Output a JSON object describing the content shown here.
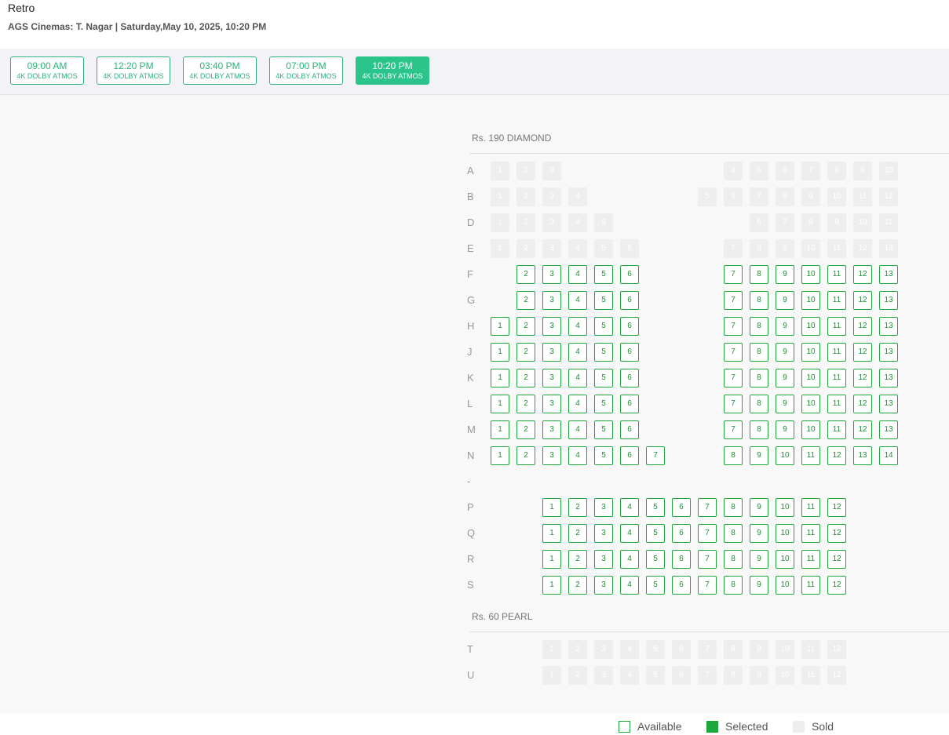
{
  "header": {
    "title": "Retro",
    "theatre": "AGS Cinemas: T. Nagar | Saturday,May 10, 2025, 10:20 PM"
  },
  "showtimes": [
    {
      "time": "09:00 AM",
      "format": "4K DOLBY ATMOS",
      "selected": false
    },
    {
      "time": "12:20 PM",
      "format": "4K DOLBY ATMOS",
      "selected": false
    },
    {
      "time": "03:40 PM",
      "format": "4K DOLBY ATMOS",
      "selected": false
    },
    {
      "time": "07:00 PM",
      "format": "4K DOLBY ATMOS",
      "selected": false
    },
    {
      "time": "10:20 PM",
      "format": "4K DOLBY ATMOS",
      "selected": true
    }
  ],
  "sections": [
    {
      "label": "Rs. 190 DIAMOND",
      "rows": [
        {
          "label": "A",
          "status": "sold",
          "seats": [
            [
              1,
              1
            ],
            [
              2,
              2
            ],
            [
              3,
              3
            ],
            [
              10,
              4
            ],
            [
              11,
              5
            ],
            [
              12,
              6
            ],
            [
              13,
              7
            ],
            [
              14,
              8
            ],
            [
              15,
              9
            ],
            [
              16,
              10
            ]
          ]
        },
        {
          "label": "B",
          "status": "sold",
          "seats": [
            [
              1,
              1
            ],
            [
              2,
              2
            ],
            [
              3,
              3
            ],
            [
              4,
              4
            ],
            [
              9,
              5
            ],
            [
              10,
              6
            ],
            [
              11,
              7
            ],
            [
              12,
              8
            ],
            [
              13,
              9
            ],
            [
              14,
              10
            ],
            [
              15,
              11
            ],
            [
              16,
              12
            ]
          ]
        },
        {
          "label": "D",
          "status": "sold",
          "seats": [
            [
              1,
              1
            ],
            [
              2,
              2
            ],
            [
              3,
              3
            ],
            [
              4,
              4
            ],
            [
              5,
              5
            ],
            [
              11,
              6
            ],
            [
              12,
              7
            ],
            [
              13,
              8
            ],
            [
              14,
              9
            ],
            [
              15,
              10
            ],
            [
              16,
              11
            ]
          ]
        },
        {
          "label": "E",
          "status": "sold",
          "seats": [
            [
              1,
              1
            ],
            [
              2,
              2
            ],
            [
              3,
              3
            ],
            [
              4,
              4
            ],
            [
              5,
              5
            ],
            [
              6,
              6
            ],
            [
              10,
              7
            ],
            [
              11,
              8
            ],
            [
              12,
              9
            ],
            [
              13,
              10
            ],
            [
              14,
              11
            ],
            [
              15,
              12
            ],
            [
              16,
              13
            ]
          ]
        },
        {
          "label": "F",
          "status": "available",
          "seats": [
            [
              2,
              2
            ],
            [
              3,
              3
            ],
            [
              4,
              4
            ],
            [
              5,
              5
            ],
            [
              6,
              6
            ],
            [
              10,
              7
            ],
            [
              11,
              8
            ],
            [
              12,
              9
            ],
            [
              13,
              10
            ],
            [
              14,
              11
            ],
            [
              15,
              12
            ],
            [
              16,
              13
            ]
          ]
        },
        {
          "label": "G",
          "status": "available",
          "seats": [
            [
              2,
              2
            ],
            [
              3,
              3
            ],
            [
              4,
              4
            ],
            [
              5,
              5
            ],
            [
              6,
              6
            ],
            [
              10,
              7
            ],
            [
              11,
              8
            ],
            [
              12,
              9
            ],
            [
              13,
              10
            ],
            [
              14,
              11
            ],
            [
              15,
              12
            ],
            [
              16,
              13
            ]
          ]
        },
        {
          "label": "H",
          "status": "available",
          "seats": [
            [
              1,
              1
            ],
            [
              2,
              2
            ],
            [
              3,
              3
            ],
            [
              4,
              4
            ],
            [
              5,
              5
            ],
            [
              6,
              6
            ],
            [
              10,
              7
            ],
            [
              11,
              8
            ],
            [
              12,
              9
            ],
            [
              13,
              10
            ],
            [
              14,
              11
            ],
            [
              15,
              12
            ],
            [
              16,
              13
            ]
          ]
        },
        {
          "label": "J",
          "status": "available",
          "seats": [
            [
              1,
              1
            ],
            [
              2,
              2
            ],
            [
              3,
              3
            ],
            [
              4,
              4
            ],
            [
              5,
              5
            ],
            [
              6,
              6
            ],
            [
              10,
              7
            ],
            [
              11,
              8
            ],
            [
              12,
              9
            ],
            [
              13,
              10
            ],
            [
              14,
              11
            ],
            [
              15,
              12
            ],
            [
              16,
              13
            ]
          ]
        },
        {
          "label": "K",
          "status": "available",
          "seats": [
            [
              1,
              1
            ],
            [
              2,
              2
            ],
            [
              3,
              3
            ],
            [
              4,
              4
            ],
            [
              5,
              5
            ],
            [
              6,
              6
            ],
            [
              10,
              7
            ],
            [
              11,
              8
            ],
            [
              12,
              9
            ],
            [
              13,
              10
            ],
            [
              14,
              11
            ],
            [
              15,
              12
            ],
            [
              16,
              13
            ]
          ]
        },
        {
          "label": "L",
          "status": "available",
          "seats": [
            [
              1,
              1
            ],
            [
              2,
              2
            ],
            [
              3,
              3
            ],
            [
              4,
              4
            ],
            [
              5,
              5
            ],
            [
              6,
              6
            ],
            [
              10,
              7
            ],
            [
              11,
              8
            ],
            [
              12,
              9
            ],
            [
              13,
              10
            ],
            [
              14,
              11
            ],
            [
              15,
              12
            ],
            [
              16,
              13
            ]
          ]
        },
        {
          "label": "M",
          "status": "available",
          "seats": [
            [
              1,
              1
            ],
            [
              2,
              2
            ],
            [
              3,
              3
            ],
            [
              4,
              4
            ],
            [
              5,
              5
            ],
            [
              6,
              6
            ],
            [
              10,
              7
            ],
            [
              11,
              8
            ],
            [
              12,
              9
            ],
            [
              13,
              10
            ],
            [
              14,
              11
            ],
            [
              15,
              12
            ],
            [
              16,
              13
            ]
          ]
        },
        {
          "label": "N",
          "status": "available",
          "seats": [
            [
              1,
              1
            ],
            [
              2,
              2
            ],
            [
              3,
              3
            ],
            [
              4,
              4
            ],
            [
              5,
              5
            ],
            [
              6,
              6
            ],
            [
              7,
              7
            ],
            [
              10,
              8
            ],
            [
              11,
              9
            ],
            [
              12,
              10
            ],
            [
              13,
              11
            ],
            [
              14,
              12
            ],
            [
              15,
              13
            ],
            [
              16,
              14
            ]
          ]
        },
        {
          "label": "-",
          "status": "gap",
          "seats": []
        },
        {
          "label": "P",
          "status": "available",
          "seats": [
            [
              3,
              1
            ],
            [
              4,
              2
            ],
            [
              5,
              3
            ],
            [
              6,
              4
            ],
            [
              7,
              5
            ],
            [
              8,
              6
            ],
            [
              9,
              7
            ],
            [
              10,
              8
            ],
            [
              11,
              9
            ],
            [
              12,
              10
            ],
            [
              13,
              11
            ],
            [
              14,
              12
            ]
          ]
        },
        {
          "label": "Q",
          "status": "available",
          "seats": [
            [
              3,
              1
            ],
            [
              4,
              2
            ],
            [
              5,
              3
            ],
            [
              6,
              4
            ],
            [
              7,
              5
            ],
            [
              8,
              6
            ],
            [
              9,
              7
            ],
            [
              10,
              8
            ],
            [
              11,
              9
            ],
            [
              12,
              10
            ],
            [
              13,
              11
            ],
            [
              14,
              12
            ]
          ]
        },
        {
          "label": "R",
          "status": "available",
          "seats": [
            [
              3,
              1
            ],
            [
              4,
              2
            ],
            [
              5,
              3
            ],
            [
              6,
              4
            ],
            [
              7,
              5
            ],
            [
              8,
              6
            ],
            [
              9,
              7
            ],
            [
              10,
              8
            ],
            [
              11,
              9
            ],
            [
              12,
              10
            ],
            [
              13,
              11
            ],
            [
              14,
              12
            ]
          ]
        },
        {
          "label": "S",
          "status": "available",
          "seats": [
            [
              3,
              1
            ],
            [
              4,
              2
            ],
            [
              5,
              3
            ],
            [
              6,
              4
            ],
            [
              7,
              5
            ],
            [
              8,
              6
            ],
            [
              9,
              7
            ],
            [
              10,
              8
            ],
            [
              11,
              9
            ],
            [
              12,
              10
            ],
            [
              13,
              11
            ],
            [
              14,
              12
            ]
          ]
        }
      ]
    },
    {
      "label": "Rs. 60 PEARL",
      "rows": [
        {
          "label": "T",
          "status": "sold",
          "seats": [
            [
              3,
              1
            ],
            [
              4,
              2
            ],
            [
              5,
              3
            ],
            [
              6,
              4
            ],
            [
              7,
              5
            ],
            [
              8,
              6
            ],
            [
              9,
              7
            ],
            [
              10,
              8
            ],
            [
              11,
              9
            ],
            [
              12,
              10
            ],
            [
              13,
              11
            ],
            [
              14,
              12
            ]
          ]
        },
        {
          "label": "U",
          "status": "sold",
          "seats": [
            [
              3,
              1
            ],
            [
              4,
              2
            ],
            [
              5,
              3
            ],
            [
              6,
              4
            ],
            [
              7,
              5
            ],
            [
              8,
              6
            ],
            [
              9,
              7
            ],
            [
              10,
              8
            ],
            [
              11,
              9
            ],
            [
              12,
              10
            ],
            [
              13,
              11
            ],
            [
              14,
              12
            ]
          ]
        }
      ]
    }
  ],
  "legend": {
    "available": "Available",
    "selected": "Selected",
    "sold": "Sold"
  },
  "colors": {
    "available_border": "#1ea83c",
    "selected_fill": "#1ea83c",
    "sold_fill": "#eeeeee",
    "showtime_active": "#2bc48a"
  }
}
